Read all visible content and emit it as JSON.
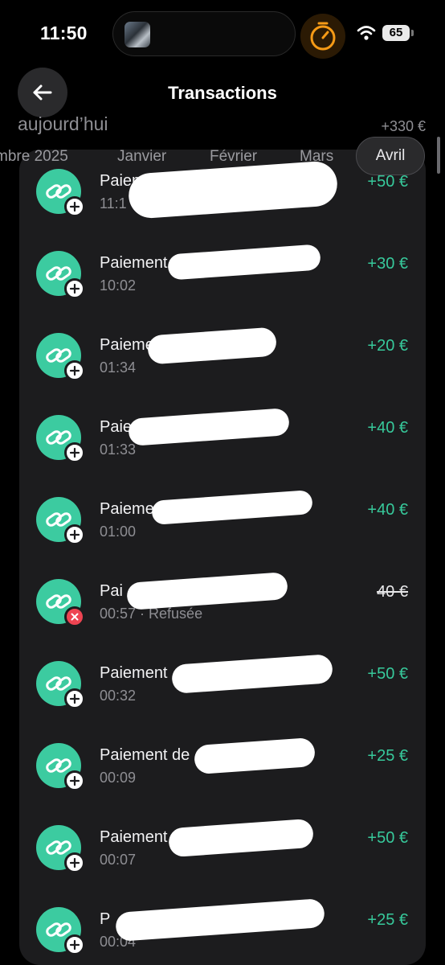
{
  "status_bar": {
    "time": "11:50",
    "battery": "65"
  },
  "header": {
    "title": "Transactions"
  },
  "group": {
    "label": "aujourd’hui",
    "total": "+330 €"
  },
  "months": [
    {
      "label": "mbre 2025",
      "active": false
    },
    {
      "label": "Janvier",
      "active": false
    },
    {
      "label": "Février",
      "active": false
    },
    {
      "label": "Mars",
      "active": false
    },
    {
      "label": "Avril",
      "active": true
    }
  ],
  "transactions": [
    {
      "title": "Paiement d",
      "time": "11:1",
      "amount": "+50 €",
      "status": "ok"
    },
    {
      "title": "Paiement",
      "time": "10:02",
      "amount": "+30 €",
      "status": "ok"
    },
    {
      "title": "Paiement d",
      "time": "01:34",
      "amount": "+20 €",
      "status": "ok"
    },
    {
      "title": "Paiem",
      "time": "01:33",
      "amount": "+40 €",
      "status": "ok"
    },
    {
      "title": "Paiement de",
      "time": "01:00",
      "amount": "+40 €",
      "status": "ok"
    },
    {
      "title": "Pai",
      "time": "00:57 · Refusée",
      "amount": "40 €",
      "status": "refused"
    },
    {
      "title": "Paiement",
      "time": "00:32",
      "amount": "+50 €",
      "status": "ok"
    },
    {
      "title": "Paiement de",
      "time": "00:09",
      "amount": "+25 €",
      "status": "ok"
    },
    {
      "title": "Paiement",
      "time": "00:07",
      "amount": "+50 €",
      "status": "ok"
    },
    {
      "title": "P",
      "time": "00:04",
      "amount": "+25 €",
      "status": "ok"
    }
  ],
  "colors": {
    "accent_green": "#37c99b",
    "avatar_green": "#3ccba0",
    "refused_red": "#ee4452",
    "timer_orange": "#f59a16"
  },
  "icons": {
    "back": "arrow-left-icon",
    "transaction": "link-icon",
    "badge_ok": "plus-icon",
    "badge_refused": "x-icon"
  }
}
